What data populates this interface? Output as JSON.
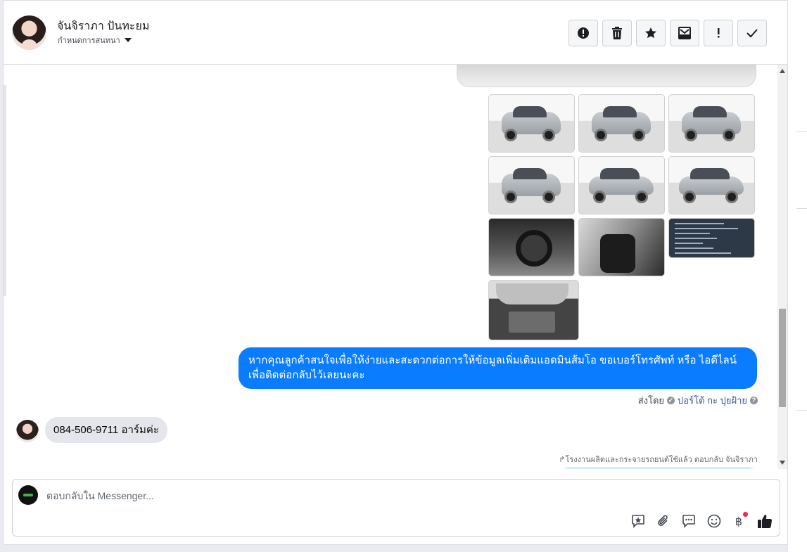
{
  "header": {
    "contact_name": "จันจิราภา ปันทะยม",
    "assign_label": "กำหนดการสนทนา",
    "buttons": [
      {
        "name": "report",
        "icon": "alert-circle-icon"
      },
      {
        "name": "delete",
        "icon": "trash-icon"
      },
      {
        "name": "star",
        "icon": "star-icon"
      },
      {
        "name": "move",
        "icon": "inbox-icon"
      },
      {
        "name": "priority",
        "icon": "exclamation-icon"
      },
      {
        "name": "done",
        "icon": "check-icon"
      }
    ]
  },
  "conversation": {
    "gallery_count": 10,
    "outgoing_message": "หากคุณลูกค้าสนใจเพื่อให้ง่ายและสะดวกต่อการให้ข้อมูลเพิ่มเติมแอดมินส้มโอ ขอเบอร์โทรศัพท์ หรือ ไอดีไลน์ เพื่อติดต่อกลับไว้เลยนะคะ",
    "sent_by_prefix": "ส่งโดย",
    "sent_by_name": "ปอร์โต้ กะ ปุยฝ้าย",
    "incoming_message": "084-506-9711 อาร์มค่ะ",
    "reply_note": "โรงงานผลิตและกระจายรถยนต์ใช้แล้ว ตอบกลับ จันจิราภา"
  },
  "composer": {
    "placeholder": "ตอบกลับใน Messenger...",
    "tools": [
      "saved-reply-icon",
      "attachment-icon",
      "chat-icon",
      "emoji-icon",
      "baht-icon",
      "like-icon"
    ],
    "baht_symbol": "฿"
  },
  "colors": {
    "outgoing_bubble": "#0a7cff",
    "incoming_bubble": "#e4e6eb",
    "link": "#385898",
    "notification_dot": "#f02849"
  }
}
